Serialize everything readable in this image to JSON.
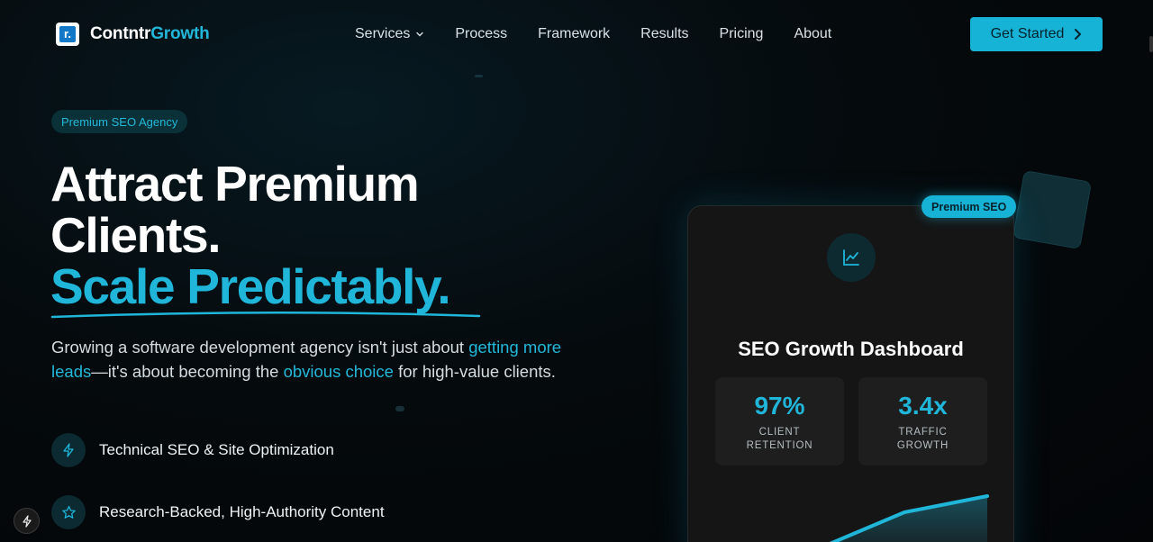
{
  "brand": {
    "name_white": "Contntr",
    "name_accent": "Growth",
    "mark_letter": "r."
  },
  "nav": {
    "items": [
      {
        "label": "Services",
        "has_dropdown": true
      },
      {
        "label": "Process"
      },
      {
        "label": "Framework"
      },
      {
        "label": "Results"
      },
      {
        "label": "Pricing"
      },
      {
        "label": "About"
      }
    ],
    "cta_label": "Get Started"
  },
  "hero": {
    "badge": "Premium SEO Agency",
    "headline_line1": "Attract Premium",
    "headline_line2": "Clients.",
    "headline_accent": "Scale Predictably.",
    "sub_1": "Growing a software development agency isn't just about ",
    "sub_hl1": "getting more leads",
    "sub_2": "—it's about becoming the ",
    "sub_hl2": "obvious choice",
    "sub_3": " for high-value clients.",
    "features": [
      {
        "icon": "bolt-icon",
        "label": "Technical SEO & Site Optimization"
      },
      {
        "icon": "star-icon",
        "label": "Research-Backed, High-Authority Content"
      }
    ]
  },
  "card": {
    "pill": "Premium SEO",
    "icon": "line-chart-icon",
    "title": "SEO Growth Dashboard",
    "stats": [
      {
        "value": "97%",
        "label": "CLIENT RETENTION"
      },
      {
        "value": "3.4x",
        "label": "TRAFFIC GROWTH"
      }
    ]
  },
  "colors": {
    "accent": "#17b3d6",
    "background": "#050a0d",
    "card": "#151515"
  }
}
